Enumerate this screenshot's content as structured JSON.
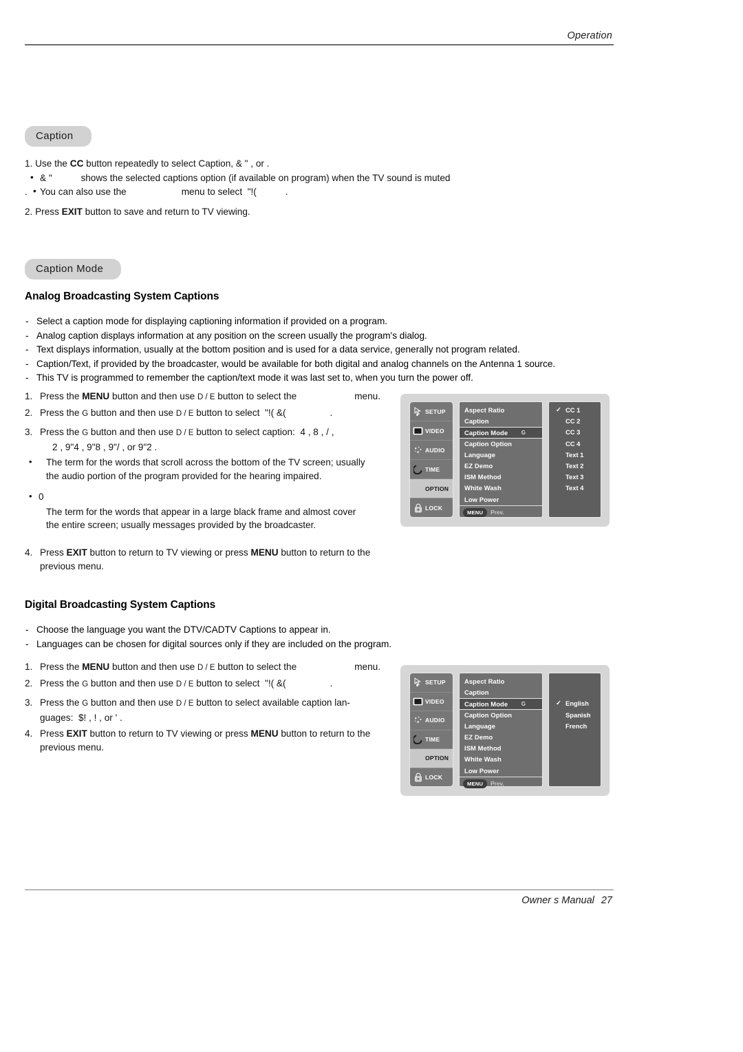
{
  "header": {
    "title": "Operation"
  },
  "footer": {
    "manual": "Owner s Manual",
    "page": "27"
  },
  "caption_section": {
    "pill": "Caption",
    "step1_a": "1. Use the ",
    "step1_cc": "CC",
    "step1_b": " button repeatedly to select Caption",
    "step1_glyphs": ",    &  \"        , or       .",
    "bullet1_glyph": "&  \"",
    "bullet1_text": "shows the selected captions option (if available on program) when the TV sound is muted",
    "bullet2_lead": ".",
    "bullet2_a": "You can also use the",
    "bullet2_b": "menu to select",
    "bullet2_glyph": "\"!(",
    "bullet2_end": ".",
    "step2_a": "2. Press ",
    "step2_exit": "EXIT",
    "step2_b": " button to save and return to TV viewing."
  },
  "caption_mode_section": {
    "pill": "Caption Mode",
    "analog_heading": "Analog Broadcasting System Captions",
    "analog_dashes": [
      "Select a caption mode for displaying captioning information if provided on a program.",
      "Analog caption displays information at any position on the screen usually the program's dialog.",
      "Text displays information, usually at the bottom position and is used for a data service, generally not program related.",
      "Caption/Text, if provided by the broadcaster, would be available for both digital and analog channels on the Antenna 1 source.",
      "This TV is programmed to remember the caption/text mode it was last set to, when you turn the power off."
    ],
    "analog_steps": {
      "s1_pre": "Press the ",
      "s1_menu": "MENU",
      "s1_mid": " button and then use ",
      "s1_keys": "D  / E",
      "s1_post": " button to select the",
      "s1_end": "menu.",
      "s2_pre": "Press the ",
      "s2_g": "G",
      "s2_mid": " button and then use ",
      "s2_keys": "D  / E",
      "s2_post": " button to select",
      "s2_glyph": "\"!(  &(",
      "s2_end": ".",
      "s3_pre": "Press the ",
      "s3_g": "G",
      "s3_mid": " button and then use ",
      "s3_keys": "D  / E",
      "s3_post": " button to select caption:",
      "s3_glyphs_1": "4     ,   8    ,   /     ,",
      "s3_glyphs_2": "2     ,   9\"4   ,   9\"8   ,   9\"/     , or   9\"2   .",
      "s4_pre": "Press ",
      "s4_exit": "EXIT",
      "s4_mid": " button to return to TV viewing or press ",
      "s4_menu": "MENU",
      "s4_post": " button to return to the",
      "s4_line2": "previous menu."
    },
    "analog_bullets": [
      {
        "glyph": "",
        "text_l1": "The term for the words that scroll across the bottom of the TV screen; usually",
        "text_l2": "the audio portion of the program provided for the hearing impaired."
      },
      {
        "glyph": "0",
        "text_l1": "The term for the words that appear in a large black frame and almost cover",
        "text_l2": "the entire screen; usually messages provided by the broadcaster."
      }
    ],
    "digital_heading": "Digital Broadcasting System Captions",
    "digital_dashes": [
      "Choose the language you want the DTV/CADTV Captions to appear in.",
      "Languages can be chosen for digital sources only if they are included on the program."
    ],
    "digital_steps": {
      "s1_pre": "Press the ",
      "s1_menu": "MENU",
      "s1_mid": " button and then use ",
      "s1_keys": "D  / E",
      "s1_post": " button to select the",
      "s1_end": "menu.",
      "s2_pre": "Press the ",
      "s2_g": "G",
      "s2_mid": " button and then use ",
      "s2_keys": "D  / E",
      "s2_post": " button to select",
      "s2_glyph": "\"!(  &(",
      "s2_end": ".",
      "s3_pre": "Press the ",
      "s3_g": "G",
      "s3_mid": " button and then use ",
      "s3_keys": "D  / E",
      "s3_post": " button to select  available  caption  lan-",
      "s3_line2_lbl": "guages:",
      "s3_glyphs": "$!        ,     !          , or  '            .",
      "s4_pre": "Press ",
      "s4_exit": "EXIT",
      "s4_mid": " button to return to TV viewing or press ",
      "s4_menu": "MENU",
      "s4_post": " button to return to the",
      "s4_line2": "previous menu."
    }
  },
  "osd": {
    "rail": [
      {
        "label": "SETUP",
        "icon": "pointer-icon",
        "selected": false
      },
      {
        "label": "VIDEO",
        "icon": "screen-icon",
        "selected": false
      },
      {
        "label": "AUDIO",
        "icon": "speaker-icon",
        "selected": false
      },
      {
        "label": "TIME",
        "icon": "clock-arc-icon",
        "selected": false
      },
      {
        "label": "OPTION",
        "icon": "none",
        "selected": true
      },
      {
        "label": "LOCK",
        "icon": "padlock-icon",
        "selected": false
      }
    ],
    "menu_items": [
      {
        "label": "Aspect Ratio",
        "highlighted": false,
        "arrow": ""
      },
      {
        "label": "Caption",
        "highlighted": false,
        "arrow": ""
      },
      {
        "label": "Caption Mode",
        "highlighted": true,
        "arrow": "G"
      },
      {
        "label": "Caption Option",
        "highlighted": false,
        "arrow": ""
      },
      {
        "label": "Language",
        "highlighted": false,
        "arrow": ""
      },
      {
        "label": "EZ Demo",
        "highlighted": false,
        "arrow": ""
      },
      {
        "label": "ISM Method",
        "highlighted": false,
        "arrow": ""
      },
      {
        "label": "White Wash",
        "highlighted": false,
        "arrow": ""
      },
      {
        "label": "Low Power",
        "highlighted": false,
        "arrow": ""
      }
    ],
    "menu_chip": "MENU",
    "prev_label": "Prev.",
    "analog_options": [
      {
        "label": "CC 1",
        "checked": true
      },
      {
        "label": "CC 2",
        "checked": false
      },
      {
        "label": "CC 3",
        "checked": false
      },
      {
        "label": "CC 4",
        "checked": false
      },
      {
        "label": "Text 1",
        "checked": false
      },
      {
        "label": "Text 2",
        "checked": false
      },
      {
        "label": "Text 3",
        "checked": false
      },
      {
        "label": "Text 4",
        "checked": false
      }
    ],
    "digital_options": [
      {
        "label": "English",
        "checked": true
      },
      {
        "label": "Spanish",
        "checked": false
      },
      {
        "label": "French",
        "checked": false
      }
    ],
    "check_glyph": "✓"
  },
  "colors": {
    "pill_bg": "#d2d2d2",
    "osd_bg": "#d6d6d6",
    "rail_bg": "#777777",
    "menu_bg": "#6f6f6f",
    "menu_hl": "#4e4e4e",
    "options_bg": "#5e5e5e",
    "selected_rail": "#c8c8c8"
  }
}
